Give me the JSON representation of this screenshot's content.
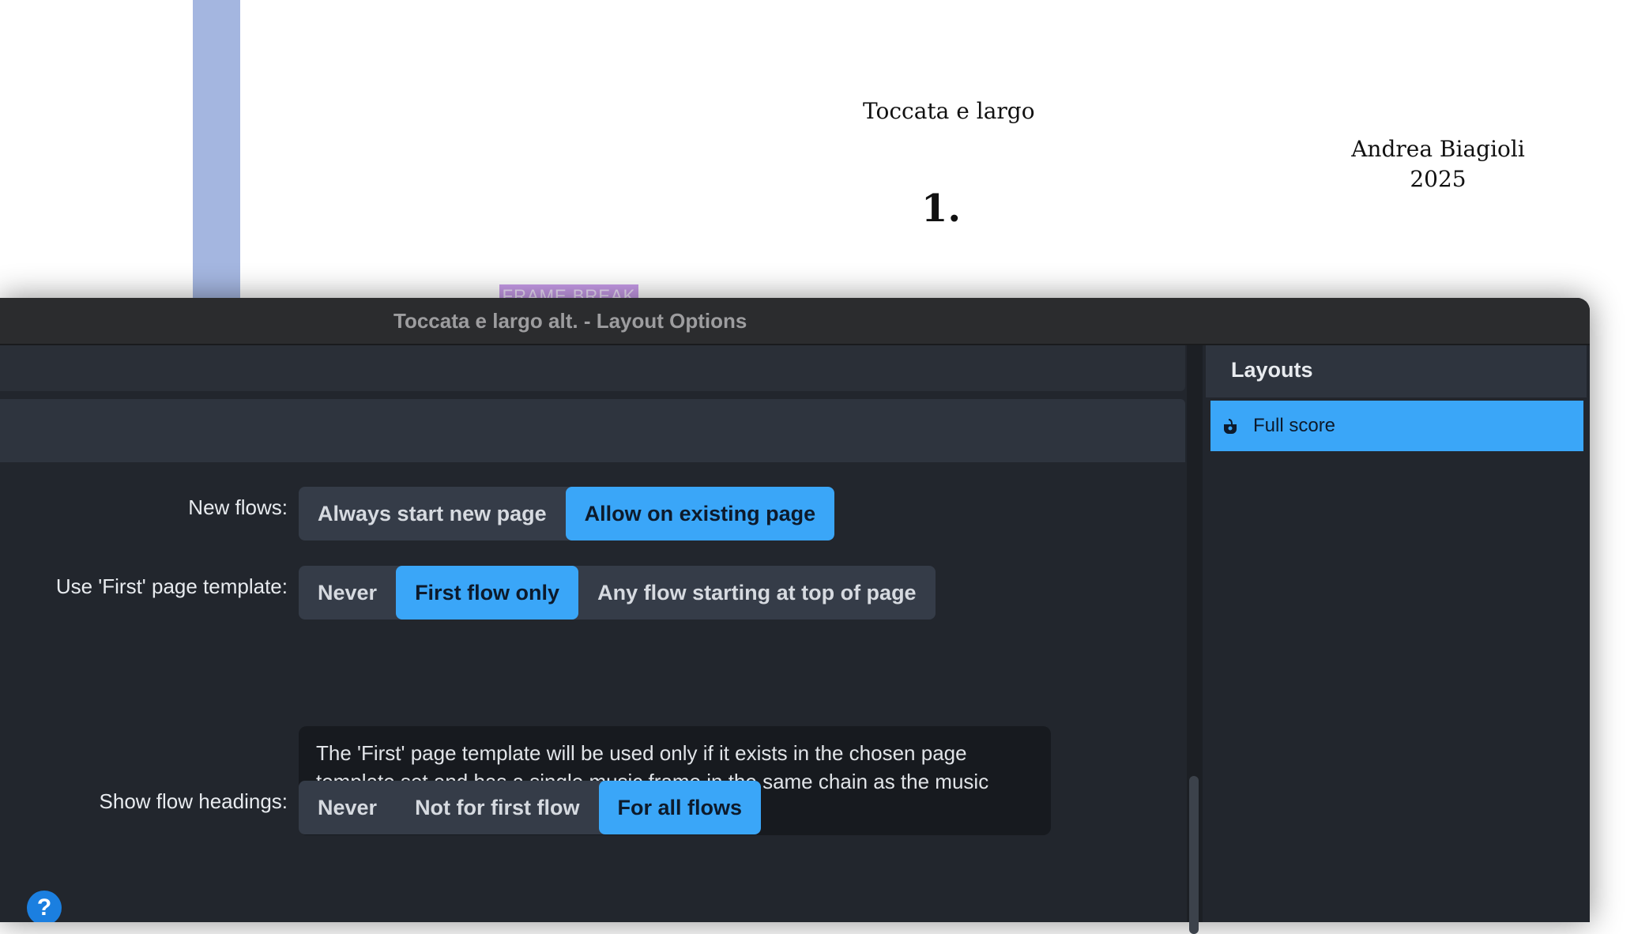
{
  "score": {
    "title": "Toccata e largo",
    "composer_lines": [
      "Andrea Biagioli",
      "2025"
    ],
    "flow_number": "1.",
    "frame_break": "FRAME BREAK"
  },
  "dialog": {
    "window_title": "Toccata e largo alt. - Layout Options",
    "new_flows": {
      "label": "New flows:",
      "options": [
        "Always start new page",
        "Allow on existing page"
      ],
      "selected": "Allow on existing page"
    },
    "first_page_template": {
      "label": "Use 'First' page template:",
      "options": [
        "Never",
        "First flow only",
        "Any flow starting at top of page"
      ],
      "selected": "First flow only",
      "info": "The 'First' page template will be used only if it exists in the chosen page template set and has a single music frame in the same chain as the music frame on the 'Default' page template pair."
    },
    "flow_headings": {
      "label": "Show flow headings:",
      "options": [
        "Never",
        "Not for first flow",
        "For all flows"
      ],
      "selected": "For all flows"
    },
    "help_icon": "?",
    "layouts": {
      "title": "Layouts",
      "items": [
        {
          "label": "Full score",
          "icon": "full-score-icon",
          "selected": true
        }
      ]
    }
  },
  "colors": {
    "accent": "#3aa6f8",
    "panel": "#22262d",
    "title_bar": "#2b2c2e",
    "help": "#1b7fe0"
  }
}
